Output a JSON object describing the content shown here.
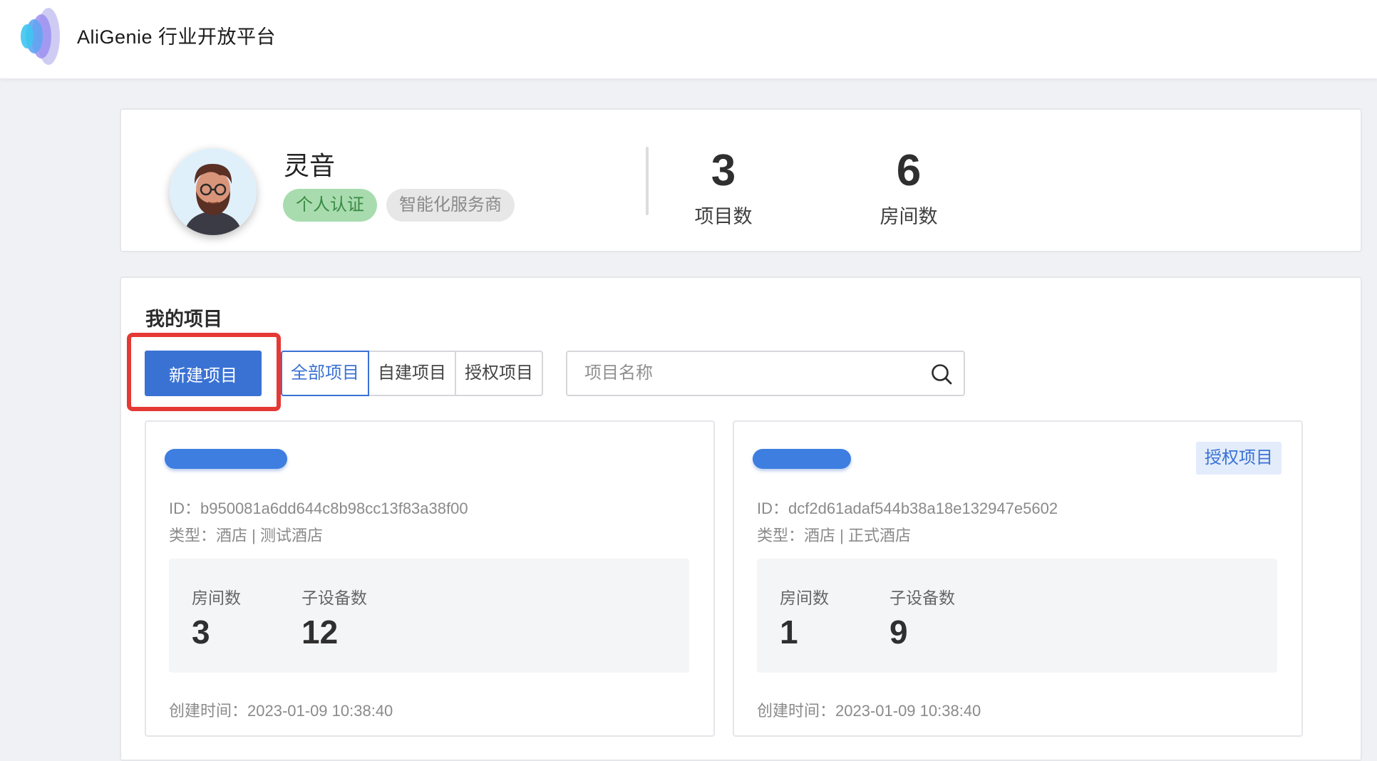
{
  "header": {
    "brand": "AliGenie 行业开放平台"
  },
  "profile": {
    "name": "灵音",
    "badges": [
      "个人认证",
      "智能化服务商"
    ],
    "stats": [
      {
        "value": "3",
        "label": "项目数"
      },
      {
        "value": "6",
        "label": "房间数"
      }
    ]
  },
  "projects": {
    "title": "我的项目",
    "new_button": "新建项目",
    "tabs": [
      "全部项目",
      "自建项目",
      "授权项目"
    ],
    "active_tab": "全部项目",
    "search_placeholder": "项目名称",
    "cards": [
      {
        "id": "ID：b950081a6dd644c8b98cc13f83a38f00",
        "type": "类型：酒店 | 测试酒店",
        "rooms_label": "房间数",
        "rooms": "3",
        "devices_label": "子设备数",
        "devices": "12",
        "created": "创建时间：2023-01-09 10:38:40",
        "tag": ""
      },
      {
        "id": "ID：dcf2d61adaf544b38a18e132947e5602",
        "type": "类型：酒店 | 正式酒店",
        "rooms_label": "房间数",
        "rooms": "1",
        "devices_label": "子设备数",
        "devices": "9",
        "created": "创建时间：2023-01-09 10:38:40",
        "tag": "授权项目"
      }
    ]
  },
  "colors": {
    "primary": "#3a72d4",
    "highlight": "#e53935",
    "badge_green": "#a8dcae",
    "badge_gray": "#e7e7e7"
  }
}
